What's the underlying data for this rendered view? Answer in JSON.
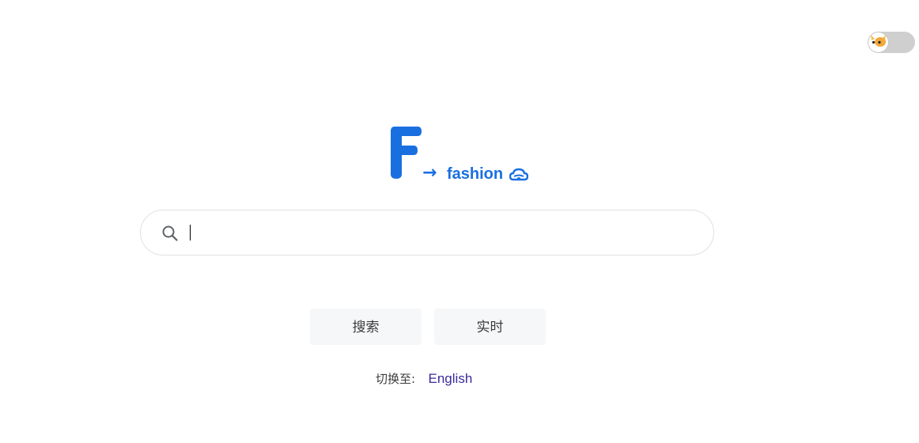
{
  "theme_toggle": {
    "icon": "cat-face-icon",
    "state": "off"
  },
  "logo": {
    "letter": "F",
    "arrow": "→",
    "word": "fashion",
    "badge_icon": "cloud-icon",
    "color": "#1a6fe0"
  },
  "search": {
    "icon": "search-icon",
    "value": "",
    "placeholder": ""
  },
  "buttons": {
    "search_label": "搜索",
    "realtime_label": "实时"
  },
  "language": {
    "label": "切换至:",
    "link_text": "English",
    "link_color": "#3a2a9c"
  }
}
